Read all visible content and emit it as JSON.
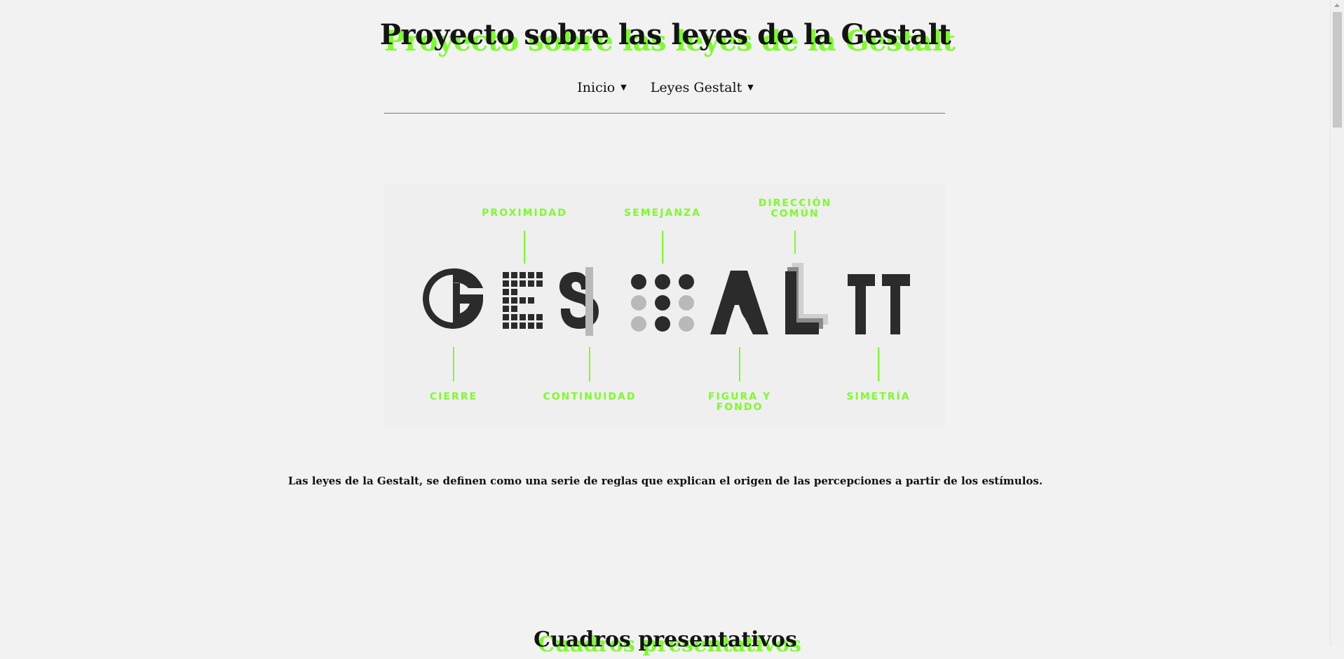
{
  "header": {
    "title": "Proyecto sobre las leyes de la Gestalt"
  },
  "nav": {
    "items": [
      {
        "label": "Inicio"
      },
      {
        "label": "Leyes Gestalt"
      }
    ],
    "caret": "▼"
  },
  "hero": {
    "colors": {
      "accent": "#7CFC2A",
      "dark": "#2b2b2b",
      "light": "#b9b9b9",
      "panel": "#efefef"
    },
    "labels": {
      "proximidad": "PROXIMIDAD",
      "semejanza": "SEMEJANZA",
      "direccion_1": "DIRECCIÓN",
      "direccion_2": "COMÚN",
      "cierre": "CIERRE",
      "continuidad": "CONTINUIDAD",
      "figura_1": "FIGURA Y",
      "figura_2": "FONDO",
      "simetria": "SIMETRÍA"
    }
  },
  "intro": {
    "text": "Las leyes de la Gestalt, se definen como una serie de reglas que explican el origen de las percepciones a partir de los estímulos."
  },
  "section": {
    "title": "Cuadros presentativos"
  }
}
